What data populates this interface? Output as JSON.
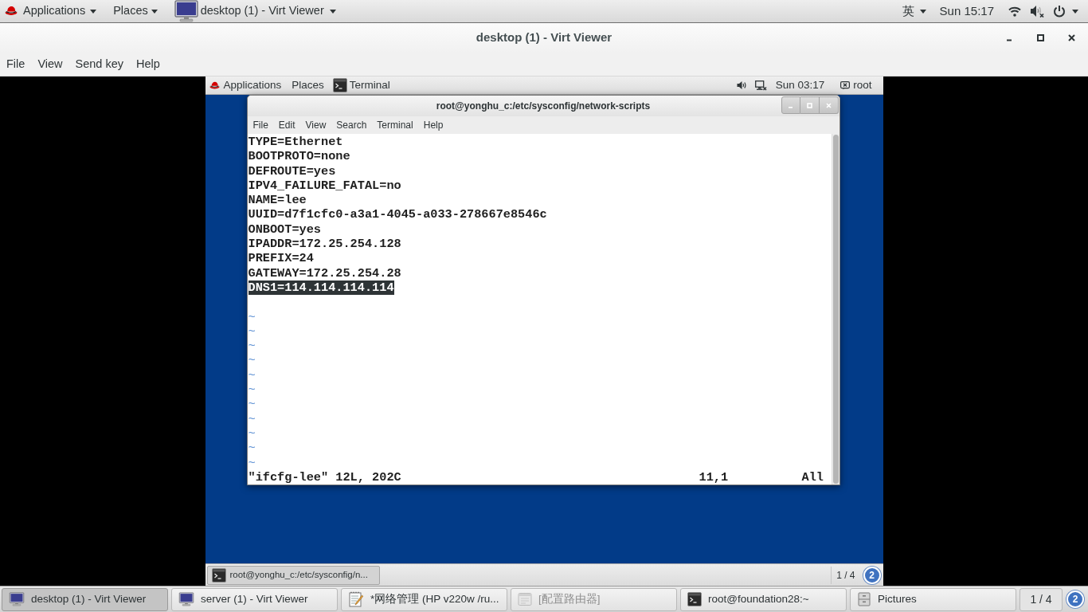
{
  "top_bar": {
    "menus": [
      "Applications",
      "Places"
    ],
    "app_menu": "desktop (1) - Virt Viewer",
    "input_method": "英",
    "clock": "Sun 15:17"
  },
  "window": {
    "title": "desktop (1) - Virt Viewer",
    "menu": [
      "File",
      "View",
      "Send key",
      "Help"
    ]
  },
  "guest": {
    "top_bar": {
      "menus": [
        "Applications",
        "Places"
      ],
      "task": "Terminal",
      "clock": "Sun 03:17",
      "user": "root"
    },
    "terminal": {
      "title": "root@yonghu_c:/etc/sysconfig/network-scripts",
      "menu": [
        "File",
        "Edit",
        "View",
        "Search",
        "Terminal",
        "Help"
      ],
      "lines": [
        {
          "kind": "text",
          "text": "TYPE=Ethernet",
          "selected": false
        },
        {
          "kind": "text",
          "text": "BOOTPROTO=none",
          "selected": false
        },
        {
          "kind": "text",
          "text": "DEFROUTE=yes",
          "selected": false
        },
        {
          "kind": "text",
          "text": "IPV4_FAILURE_FATAL=no",
          "selected": false
        },
        {
          "kind": "text",
          "text": "NAME=lee",
          "selected": false
        },
        {
          "kind": "text",
          "text": "UUID=d7f1cfc0-a3a1-4045-a033-278667e8546c",
          "selected": false
        },
        {
          "kind": "text",
          "text": "ONBOOT=yes",
          "selected": false
        },
        {
          "kind": "text",
          "text": "IPADDR=172.25.254.128",
          "selected": false
        },
        {
          "kind": "text",
          "text": "PREFIX=24",
          "selected": false
        },
        {
          "kind": "text",
          "text": "GATEWAY=172.25.254.28",
          "selected": false
        },
        {
          "kind": "text",
          "text": "DNS1=114.114.114.114",
          "selected": true
        },
        {
          "kind": "blank",
          "selected": false
        }
      ],
      "filler_lines": [
        "~",
        "~",
        "~",
        "~",
        "~",
        "~",
        "~",
        "~",
        "~",
        "~",
        "~"
      ],
      "status_line": {
        "message": "\"ifcfg-lee\" 12L, 202C",
        "cursor": "11,1",
        "scroll": "All"
      }
    },
    "bottom_panel": {
      "tasks": [
        {
          "label": "root@yonghu_c:/etc/sysconfig/n...",
          "selected": true
        }
      ],
      "workspace": "1 / 4",
      "notifications": "2"
    }
  },
  "taskbar": {
    "tasks": [
      {
        "kind": "viewer",
        "label": "desktop (1) - Virt Viewer",
        "selected": true,
        "minimized": false
      },
      {
        "kind": "viewer",
        "label": "server (1) - Virt Viewer",
        "selected": false,
        "minimized": false
      },
      {
        "kind": "editor",
        "label": "*网络管理 (HP v220w /ru...",
        "selected": false,
        "minimized": false
      },
      {
        "kind": "window",
        "label": "[配置路由器]",
        "selected": false,
        "minimized": true
      },
      {
        "kind": "terminal",
        "label": "root@foundation28:~",
        "selected": false,
        "minimized": false
      },
      {
        "kind": "files",
        "label": "Pictures",
        "selected": false,
        "minimized": false
      }
    ],
    "workspace": "1 / 4",
    "notifications": "2"
  }
}
